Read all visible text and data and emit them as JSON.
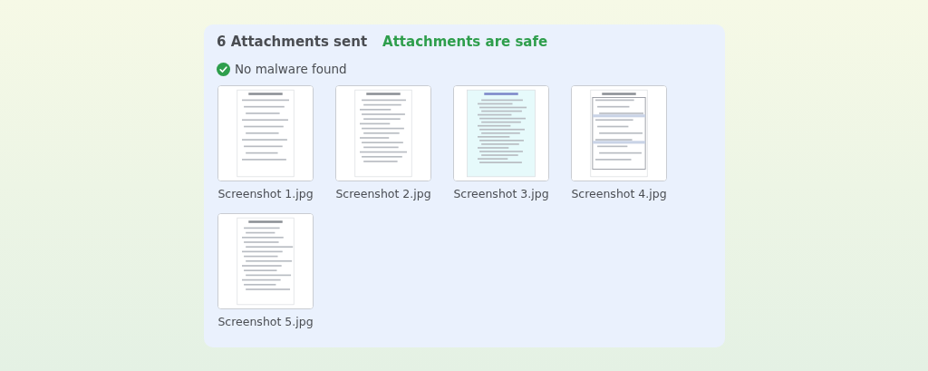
{
  "panel": {
    "title": "6 Attachments sent",
    "status": "Attachments are safe",
    "scan_result": "No malware found"
  },
  "attachments": [
    {
      "kind": "picture",
      "filename": "Screenshot 1.jpg"
    },
    {
      "kind": "picture",
      "filename": "Screenshot 2.jpg"
    },
    {
      "kind": "picture",
      "filename": "Screenshot 3.jpg"
    },
    {
      "kind": "picture",
      "filename": "Screenshot 4.jpg"
    },
    {
      "kind": "picture",
      "filename": "Screenshot 5.jpg"
    }
  ]
}
